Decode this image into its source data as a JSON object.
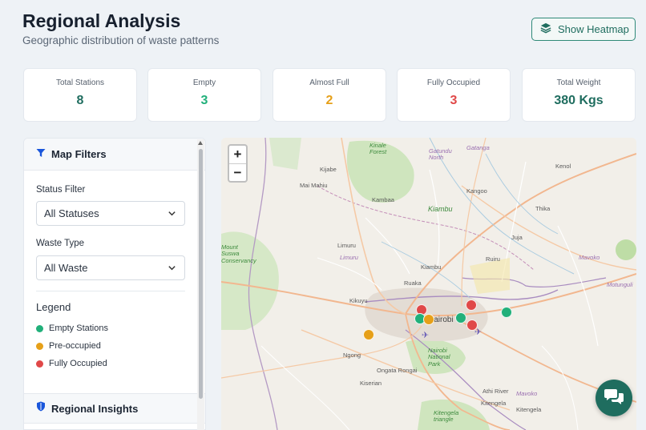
{
  "header": {
    "title": "Regional Analysis",
    "subtitle": "Geographic distribution of waste patterns",
    "heatmap_button": "Show Heatmap"
  },
  "stats": [
    {
      "label": "Total Stations",
      "value": "8",
      "color": "#1f6d5f"
    },
    {
      "label": "Empty",
      "value": "3",
      "color": "#21b07a"
    },
    {
      "label": "Almost Full",
      "value": "2",
      "color": "#e6a019"
    },
    {
      "label": "Fully Occupied",
      "value": "3",
      "color": "#e04848"
    },
    {
      "label": "Total Weight",
      "value": "380 Kgs",
      "color": "#1f6d5f"
    }
  ],
  "filters": {
    "title": "Map Filters",
    "status_label": "Status Filter",
    "status_value": "All Statuses",
    "waste_label": "Waste Type",
    "waste_value": "All Waste",
    "legend_title": "Legend",
    "legend": [
      {
        "label": "Empty Stations",
        "color": "#21b07a"
      },
      {
        "label": "Pre-occupied",
        "color": "#e6a019"
      },
      {
        "label": "Fully Occupied",
        "color": "#e04848"
      }
    ],
    "insights_title": "Regional Insights"
  },
  "map": {
    "zoom_in": "+",
    "zoom_out": "−",
    "labels": [
      {
        "text": "Kijabe",
        "style": ""
      },
      {
        "text": "Mai Mahiu",
        "style": ""
      },
      {
        "text": "Kambaa",
        "style": ""
      },
      {
        "text": "Kiambu",
        "style": "green"
      },
      {
        "text": "Kangoo",
        "style": ""
      },
      {
        "text": "Kenol",
        "style": ""
      },
      {
        "text": "Thika",
        "style": ""
      },
      {
        "text": "Juja",
        "style": ""
      },
      {
        "text": "Ruiru",
        "style": ""
      },
      {
        "text": "Limuru",
        "style": ""
      },
      {
        "text": "Kiambu",
        "style": ""
      },
      {
        "text": "Ruaka",
        "style": ""
      },
      {
        "text": "Kikuyu",
        "style": ""
      },
      {
        "text": "Ngong",
        "style": ""
      },
      {
        "text": "Ongata Rongai",
        "style": ""
      },
      {
        "text": "Kiserian",
        "style": ""
      },
      {
        "text": "Athi River",
        "style": ""
      },
      {
        "text": "Kitengela",
        "style": ""
      },
      {
        "text": "Nairobi National Park",
        "style": "green"
      },
      {
        "text": "Mount Suswa Conservancy",
        "style": "green"
      },
      {
        "text": "Motunguli",
        "style": "purple"
      },
      {
        "text": "Mavoko",
        "style": "purple"
      },
      {
        "text": "Kitengela triangle",
        "style": "green"
      },
      {
        "text": "Kinale Forest",
        "style": "green"
      },
      {
        "text": "Gatundu North",
        "style": "purple"
      },
      {
        "text": "Limuru",
        "style": "purple"
      },
      {
        "text": "Mavoko",
        "style": "purple"
      },
      {
        "text": "Gatanga",
        "style": "purple"
      },
      {
        "text": "Nairobi",
        "style": ""
      },
      {
        "text": "Kitengela",
        "style": ""
      }
    ],
    "markers": [
      {
        "status": "full",
        "color": "#e04848"
      },
      {
        "status": "full",
        "color": "#e04848"
      },
      {
        "status": "full",
        "color": "#e04848"
      },
      {
        "status": "empty",
        "color": "#21b07a"
      },
      {
        "status": "empty",
        "color": "#21b07a"
      },
      {
        "status": "empty",
        "color": "#21b07a"
      },
      {
        "status": "almost-full",
        "color": "#e6a019"
      },
      {
        "status": "almost-full",
        "color": "#e6a019"
      }
    ]
  }
}
